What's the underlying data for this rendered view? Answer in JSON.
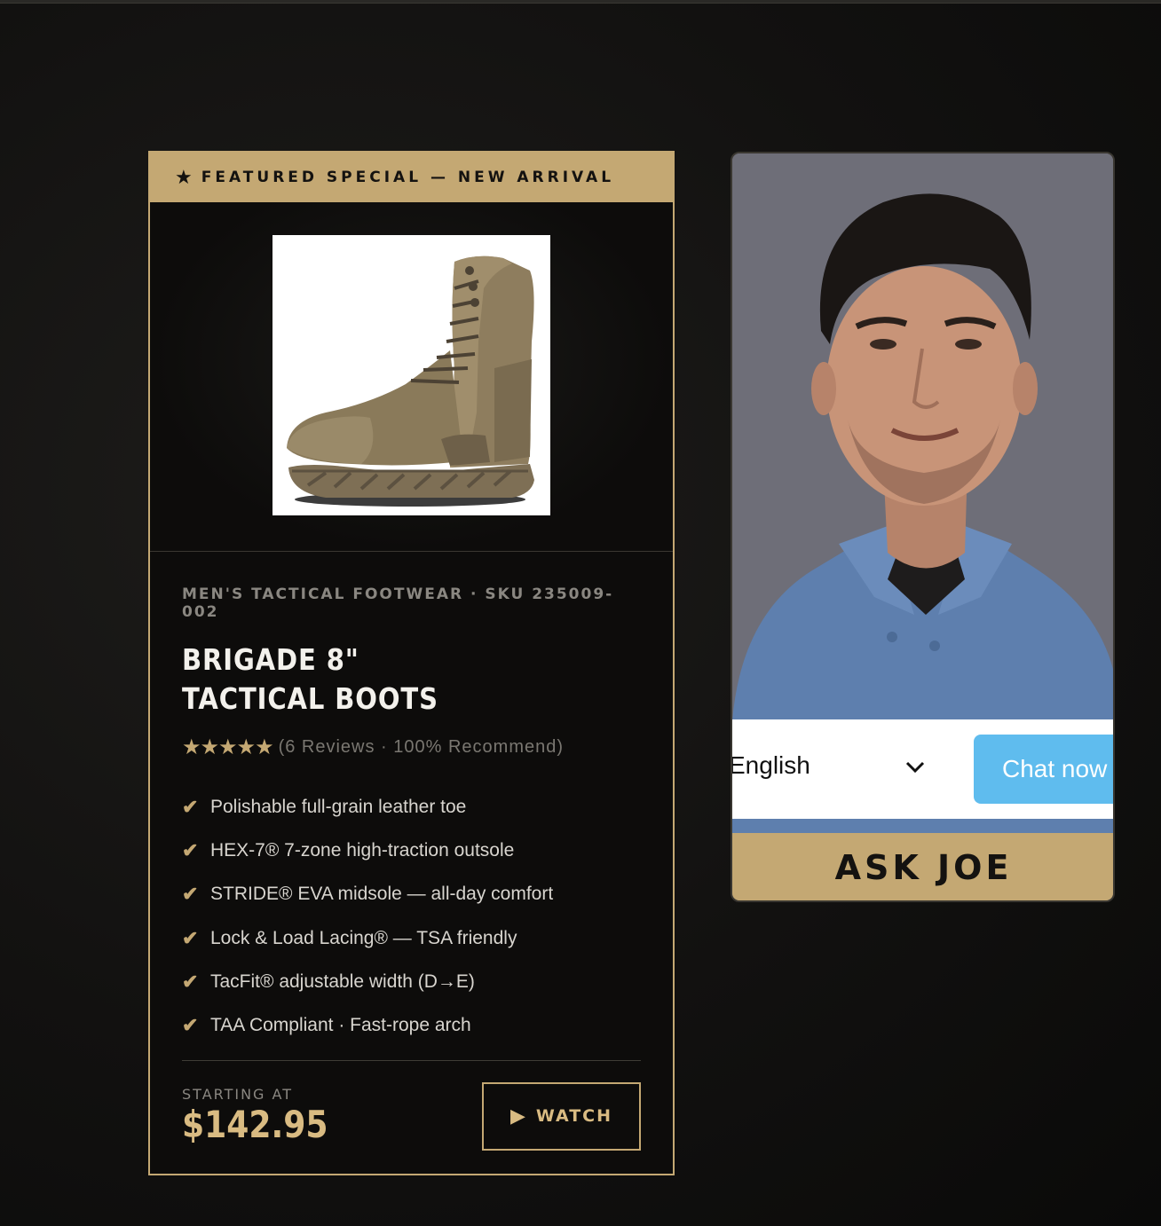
{
  "product_card": {
    "banner": {
      "icon": "star-icon",
      "text": "FEATURED SPECIAL — NEW ARRIVAL"
    },
    "image": {
      "icon": "tactical-boot-image"
    },
    "category": "MEN'S TACTICAL FOOTWEAR · SKU 235009-002",
    "title_line1": "BRIGADE 8\"",
    "title_line2": "TACTICAL BOOTS",
    "rating": {
      "stars": "★★★★★",
      "reviews_text": "(6 Reviews · 100% Recommend)"
    },
    "features": [
      "Polishable full-grain leather toe",
      "HEX-7® 7-zone high-traction outsole",
      "STRIDE® EVA midsole — all-day comfort",
      "Lock & Load Lacing® — TSA friendly",
      "TacFit® adjustable width (D→E)",
      "TAA Compliant · Fast-rope arch"
    ],
    "check_glyph": "✔",
    "price": {
      "label": "STARTING AT",
      "value": "$142.95"
    },
    "watch_button": {
      "icon": "play-icon",
      "label": "WATCH"
    }
  },
  "ask_widget": {
    "language_select": "English",
    "chat_button": "Chat now",
    "footer_label": "ASK JOE"
  },
  "colors": {
    "accent_gold": "#c4a873",
    "price_gold": "#d9bb82",
    "chat_blue": "#5fbcee",
    "background": "#121110"
  }
}
